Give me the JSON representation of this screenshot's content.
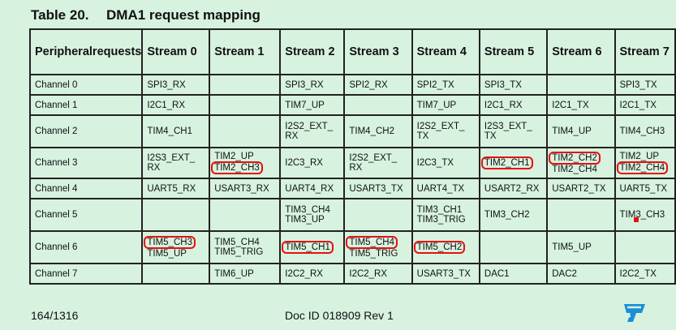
{
  "title": {
    "number": "Table 20.",
    "text": "DMA1 request mapping"
  },
  "table": {
    "corner_label_line1": "Peripheral",
    "corner_label_line2": "requests",
    "stream_headers": [
      "Stream 0",
      "Stream 1",
      "Stream 2",
      "Stream 3",
      "Stream 4",
      "Stream 5",
      "Stream 6",
      "Stream 7"
    ],
    "rows": [
      {
        "channel": "Channel 0",
        "cells": [
          {
            "l1": "SPI3_RX",
            "l2": "",
            "hl1": false,
            "hl2": false
          },
          {
            "l1": "",
            "l2": "",
            "hl1": false,
            "hl2": false
          },
          {
            "l1": "SPI3_RX",
            "l2": "",
            "hl1": false,
            "hl2": false
          },
          {
            "l1": "SPI2_RX",
            "l2": "",
            "hl1": false,
            "hl2": false
          },
          {
            "l1": "SPI2_TX",
            "l2": "",
            "hl1": false,
            "hl2": false
          },
          {
            "l1": "SPI3_TX",
            "l2": "",
            "hl1": false,
            "hl2": false
          },
          {
            "l1": "",
            "l2": "",
            "hl1": false,
            "hl2": false
          },
          {
            "l1": "SPI3_TX",
            "l2": "",
            "hl1": false,
            "hl2": false
          }
        ]
      },
      {
        "channel": "Channel 1",
        "cells": [
          {
            "l1": "I2C1_RX",
            "l2": "",
            "hl1": false,
            "hl2": false
          },
          {
            "l1": "",
            "l2": "",
            "hl1": false,
            "hl2": false
          },
          {
            "l1": "TIM7_UP",
            "l2": "",
            "hl1": false,
            "hl2": false
          },
          {
            "l1": "",
            "l2": "",
            "hl1": false,
            "hl2": false
          },
          {
            "l1": "TIM7_UP",
            "l2": "",
            "hl1": false,
            "hl2": false
          },
          {
            "l1": "I2C1_RX",
            "l2": "",
            "hl1": false,
            "hl2": false
          },
          {
            "l1": "I2C1_TX",
            "l2": "",
            "hl1": false,
            "hl2": false
          },
          {
            "l1": "I2C1_TX",
            "l2": "",
            "hl1": false,
            "hl2": false
          }
        ]
      },
      {
        "channel": "Channel 2",
        "cells": [
          {
            "l1": "TIM4_CH1",
            "l2": "",
            "hl1": false,
            "hl2": false
          },
          {
            "l1": "",
            "l2": "",
            "hl1": false,
            "hl2": false
          },
          {
            "l1": "I2S2_EXT_",
            "l2": "RX",
            "hl1": false,
            "hl2": false
          },
          {
            "l1": "TIM4_CH2",
            "l2": "",
            "hl1": false,
            "hl2": false
          },
          {
            "l1": "I2S2_EXT_",
            "l2": "TX",
            "hl1": false,
            "hl2": false
          },
          {
            "l1": "I2S3_EXT_",
            "l2": "TX",
            "hl1": false,
            "hl2": false
          },
          {
            "l1": "TIM4_UP",
            "l2": "",
            "hl1": false,
            "hl2": false
          },
          {
            "l1": "TIM4_CH3",
            "l2": "",
            "hl1": false,
            "hl2": false
          }
        ]
      },
      {
        "channel": "Channel 3",
        "cells": [
          {
            "l1": "I2S3_EXT_",
            "l2": "RX",
            "hl1": false,
            "hl2": false
          },
          {
            "l1": "TIM2_UP",
            "l2": "TIM2_CH3",
            "hl1": false,
            "hl2": true
          },
          {
            "l1": "I2C3_RX",
            "l2": "",
            "hl1": false,
            "hl2": false
          },
          {
            "l1": "I2S2_EXT_",
            "l2": "RX",
            "hl1": false,
            "hl2": false
          },
          {
            "l1": "I2C3_TX",
            "l2": "",
            "hl1": false,
            "hl2": false
          },
          {
            "l1": "TIM2_CH1",
            "l2": "",
            "hl1": true,
            "hl2": false
          },
          {
            "l1": "TIM2_CH2",
            "l2": "TIM2_CH4",
            "hl1": true,
            "hl2": false
          },
          {
            "l1": "TIM2_UP",
            "l2": "TIM2_CH4",
            "hl1": false,
            "hl2": true
          }
        ]
      },
      {
        "channel": "Channel 4",
        "cells": [
          {
            "l1": "UART5_RX",
            "l2": "",
            "hl1": false,
            "hl2": false
          },
          {
            "l1": "USART3_RX",
            "l2": "",
            "hl1": false,
            "hl2": false
          },
          {
            "l1": "UART4_RX",
            "l2": "",
            "hl1": false,
            "hl2": false
          },
          {
            "l1": "USART3_TX",
            "l2": "",
            "hl1": false,
            "hl2": false
          },
          {
            "l1": "UART4_TX",
            "l2": "",
            "hl1": false,
            "hl2": false
          },
          {
            "l1": "USART2_RX",
            "l2": "",
            "hl1": false,
            "hl2": false
          },
          {
            "l1": "USART2_TX",
            "l2": "",
            "hl1": false,
            "hl2": false
          },
          {
            "l1": "UART5_TX",
            "l2": "",
            "hl1": false,
            "hl2": false
          }
        ]
      },
      {
        "channel": "Channel 5",
        "cells": [
          {
            "l1": "",
            "l2": "",
            "hl1": false,
            "hl2": false
          },
          {
            "l1": "",
            "l2": "",
            "hl1": false,
            "hl2": false
          },
          {
            "l1": "TIM3_CH4",
            "l2": "TIM3_UP",
            "hl1": false,
            "hl2": false
          },
          {
            "l1": "",
            "l2": "",
            "hl1": false,
            "hl2": false
          },
          {
            "l1": "TIM3_CH1",
            "l2": "TIM3_TRIG",
            "hl1": false,
            "hl2": false
          },
          {
            "l1": "TIM3_CH2",
            "l2": "",
            "hl1": false,
            "hl2": false
          },
          {
            "l1": "",
            "l2": "",
            "hl1": false,
            "hl2": false
          },
          {
            "l1": "TIM3_CH3",
            "l2": "",
            "hl1": false,
            "hl2": false
          }
        ]
      },
      {
        "channel": "Channel 6",
        "cells": [
          {
            "l1": "TIM5_CH3",
            "l2": "TIM5_UP",
            "hl1": true,
            "hl2": false
          },
          {
            "l1": "TIM5_CH4",
            "l2": "TIM5_TRIG",
            "hl1": false,
            "hl2": false
          },
          {
            "l1": "TIM5_CH1",
            "l2": "",
            "hl1": true,
            "hl2": false
          },
          {
            "l1": "TIM5_CH4",
            "l2": "TIM5_TRIG",
            "hl1": true,
            "hl2": false
          },
          {
            "l1": "TIM5_CH2",
            "l2": "",
            "hl1": true,
            "hl2": false
          },
          {
            "l1": "",
            "l2": "",
            "hl1": false,
            "hl2": false
          },
          {
            "l1": "TIM5_UP",
            "l2": "",
            "hl1": false,
            "hl2": false
          },
          {
            "l1": "",
            "l2": "",
            "hl1": false,
            "hl2": false
          }
        ]
      },
      {
        "channel": "Channel 7",
        "cells": [
          {
            "l1": "",
            "l2": "",
            "hl1": false,
            "hl2": false
          },
          {
            "l1": "TIM6_UP",
            "l2": "",
            "hl1": false,
            "hl2": false
          },
          {
            "l1": "I2C2_RX",
            "l2": "",
            "hl1": false,
            "hl2": false
          },
          {
            "l1": "I2C2_RX",
            "l2": "",
            "hl1": false,
            "hl2": false
          },
          {
            "l1": "USART3_TX",
            "l2": "",
            "hl1": false,
            "hl2": false
          },
          {
            "l1": "DAC1",
            "l2": "",
            "hl1": false,
            "hl2": false
          },
          {
            "l1": "DAC2",
            "l2": "",
            "hl1": false,
            "hl2": false
          },
          {
            "l1": "I2C2_TX",
            "l2": "",
            "hl1": false,
            "hl2": false
          }
        ]
      }
    ]
  },
  "footer": {
    "page": "164/1316",
    "doc_id": "Doc ID 018909 Rev 1"
  },
  "colors": {
    "background": "#d7f2df",
    "annotation": "#e81010",
    "logo": "#1a8fd6"
  },
  "logo_icon": "st-logo-icon"
}
